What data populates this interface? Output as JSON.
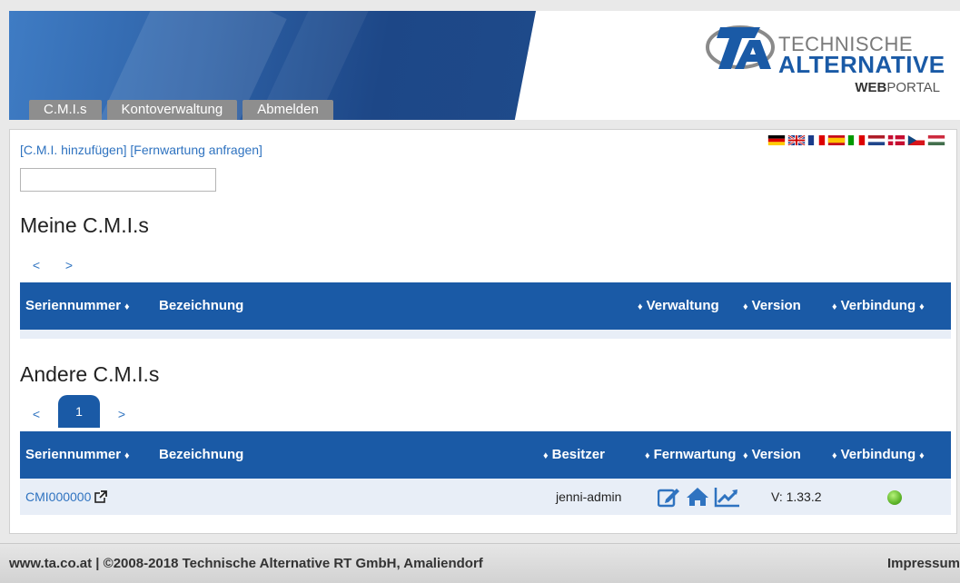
{
  "nav": {
    "tabs": [
      "C.M.I.s",
      "Kontoverwaltung",
      "Abmelden"
    ]
  },
  "logo": {
    "line1": "TECHNISCHE",
    "line2": "ALTERNATIVE",
    "line3_bold": "WEB",
    "line3_rest": "PORTAL"
  },
  "flags": [
    "flag-de-icon",
    "flag-gb-icon",
    "flag-fr-icon",
    "flag-es-icon",
    "flag-it-icon",
    "flag-nl-icon",
    "flag-dk-icon",
    "flag-cz-icon",
    "flag-hu-icon"
  ],
  "actions": {
    "add_cmi": "[C.M.I. hinzufügen]",
    "remote_request": "[Fernwartung anfragen]"
  },
  "search": {
    "value": "",
    "placeholder": ""
  },
  "my_cmis": {
    "title": "Meine C.M.I.s",
    "pager": {
      "prev": "<",
      "next": ">"
    },
    "headers": {
      "serial": "Seriennummer",
      "name": "Bezeichnung",
      "admin": "Verwaltung",
      "version": "Version",
      "connection": "Verbindung"
    },
    "sort_glyph": "♦",
    "rows": []
  },
  "other_cmis": {
    "title": "Andere C.M.I.s",
    "pager": {
      "prev": "<",
      "current": "1",
      "next": ">"
    },
    "headers": {
      "serial": "Seriennummer",
      "name": "Bezeichnung",
      "owner": "Besitzer",
      "remote": "Fernwartung",
      "version": "Version",
      "connection": "Verbindung"
    },
    "rows": [
      {
        "serial": "CMI000000",
        "name": "",
        "owner": "jenni-admin",
        "version": "V: 1.33.2",
        "connection": "online"
      }
    ]
  },
  "footer": {
    "left": "www.ta.co.at | ©2008-2018 Technische Alternative RT GmbH, Amaliendorf",
    "right": "Impressum"
  },
  "colors": {
    "brand_blue": "#1a5aa6",
    "link_blue": "#2f73c0",
    "row_bg": "#e8eef7",
    "status_online": "#5fb52a"
  }
}
